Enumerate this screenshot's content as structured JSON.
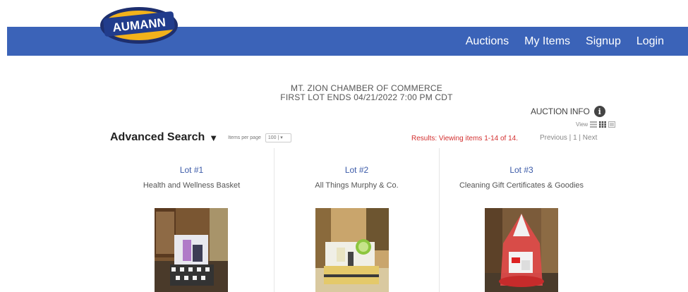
{
  "brand": {
    "logo_text": "AUMANN"
  },
  "nav": {
    "items": [
      "Auctions",
      "My Items",
      "Signup",
      "Login"
    ]
  },
  "auction": {
    "name": "MT. ZION CHAMBER OF COMMERCE",
    "ends": "FIRST LOT ENDS 04/21/2022 7:00 PM CDT",
    "info_label": "AUCTION INFO"
  },
  "view": {
    "label": "View"
  },
  "search": {
    "label": "Advanced Search",
    "items_per_page_label": "Items per page",
    "items_per_page_value": "100"
  },
  "results": {
    "text": "Results: Viewing items 1-14 of 14."
  },
  "pager": {
    "previous": "Previous",
    "page": "1",
    "next": "Next"
  },
  "lots": [
    {
      "lot": "Lot #1",
      "title": "Health and Wellness Basket"
    },
    {
      "lot": "Lot #2",
      "title": "All Things Murphy & Co."
    },
    {
      "lot": "Lot #3",
      "title": "Cleaning Gift Certificates & Goodies"
    }
  ]
}
